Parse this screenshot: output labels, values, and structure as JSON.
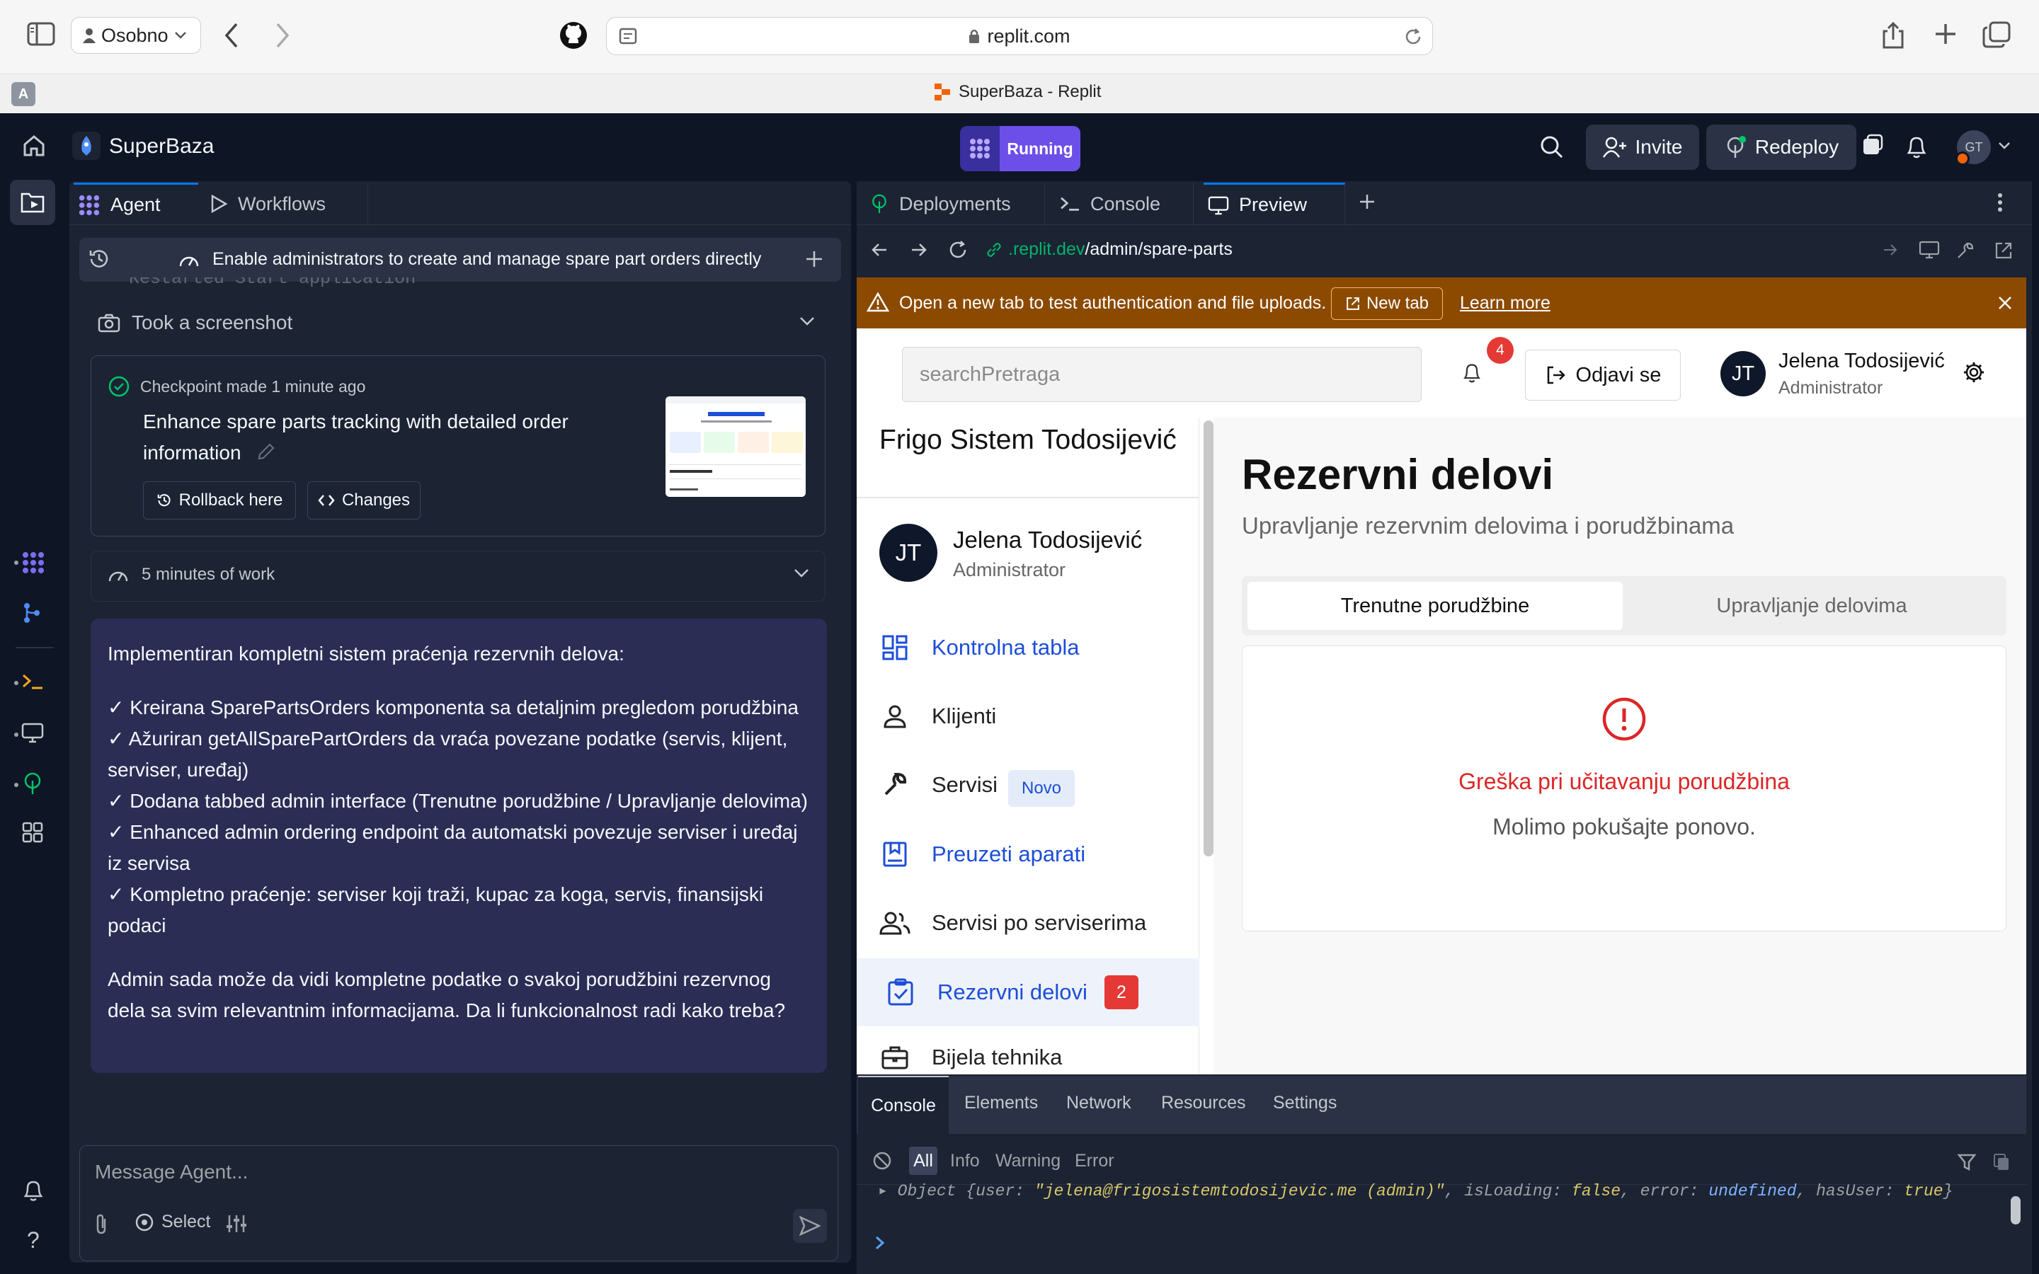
{
  "browser": {
    "profile": "Osobno",
    "url": "replit.com",
    "tab_title": "SuperBaza - Replit",
    "tab_badge": "A"
  },
  "replit": {
    "app_name": "SuperBaza",
    "status": "Running",
    "invite": "Invite",
    "redeploy": "Redeploy",
    "avatar": "GT"
  },
  "agent_panel": {
    "tabs": [
      "Agent",
      "Workflows"
    ],
    "header": "Enable administrators to create and manage spare part orders directly",
    "restarted": "Restarted Start application",
    "screenshot": "Took a screenshot",
    "checkpoint": {
      "title": "Checkpoint made 1 minute ago",
      "description": "Enhance spare parts tracking with detailed order information",
      "rollback": "Rollback here",
      "changes": "Changes"
    },
    "work": "5 minutes of work",
    "message": [
      "Implementiran kompletni sistem praćenja rezervnih delova:",
      "✓ Kreirana SparePartsOrders komponenta sa detaljnim pregledom porudžbina\n✓ Ažuriran getAllSparePartOrders da vraća povezane podatke (servis, klijent, serviser, uređaj)\n✓ Dodana tabbed admin interface (Trenutne porudžbine / Upravljanje delovima)\n✓ Enhanced admin ordering endpoint da automatski povezuje serviser i uređaj iz servisa\n✓ Kompletno praćenje: serviser koji traži, kupac za koga, servis, finansijski podaci",
      "Admin sada može da vidi kompletne podatke o svakoj porudžbini rezervnog dela sa svim relevantnim informacijama. Da li funkcionalnost radi kako treba?"
    ],
    "composer_placeholder": "Message Agent...",
    "select": "Select"
  },
  "right_panel": {
    "tabs": [
      "Deployments",
      "Console",
      "Preview"
    ],
    "url_domain": ".replit.dev",
    "url_path": "/admin/spare-parts",
    "warning": "Open a new tab to test authentication and file uploads.",
    "new_tab": "New tab",
    "learn_more": "Learn more"
  },
  "webpage": {
    "search_placeholder": "searchPretraga",
    "notifications": "4",
    "logout": "Odjavi se",
    "user_initials": "JT",
    "user_name": "Jelena Todosijević",
    "user_role": "Administrator",
    "brand": "Frigo Sistem Todosijević",
    "nav": [
      {
        "label": "Kontrolna tabla",
        "icon": "dashboard-icon"
      },
      {
        "label": "Klijenti",
        "icon": "person-icon"
      },
      {
        "label": "Servisi",
        "icon": "wrench-icon",
        "badge": "Novo"
      },
      {
        "label": "Preuzeti aparati",
        "icon": "bookmark-box-icon"
      },
      {
        "label": "Servisi po serviserima",
        "icon": "group-icon"
      },
      {
        "label": "Rezervni delovi",
        "icon": "clipboard-check-icon",
        "badge": "2"
      },
      {
        "label": "Bijela tehnika",
        "icon": "briefcase-icon"
      }
    ],
    "title": "Rezervni delovi",
    "subtitle": "Upravljanje rezervnim delovima i porudžbinama",
    "tabs": [
      "Trenutne porudžbine",
      "Upravljanje delovima"
    ],
    "error": "Greška pri učitavanju porudžbina",
    "retry": "Molimo pokušajte ponovo."
  },
  "devtools": {
    "tabs": [
      "Console",
      "Elements",
      "Network",
      "Resources",
      "Settings"
    ],
    "filters": [
      "All",
      "Info",
      "Warning",
      "Error"
    ],
    "log_prefix": "Object {user: ",
    "log_user": "\"jelena@frigosistemtodosijevic.me (admin)\"",
    "log_mid": ", isLoading: ",
    "log_loading": "false",
    "log_err": ", error: ",
    "log_undef": "undefined",
    "log_has": ", hasUser: ",
    "log_true": "true",
    "log_close": "}"
  },
  "colors": {
    "replit_bg": "#0e1525",
    "panel_bg": "#1c2333",
    "running_purple": "#6c4fe8",
    "warning_bg": "#8b4a00",
    "message_bg": "#2b2d55",
    "error_red": "#dc2626",
    "link_blue": "#1d4ed8"
  }
}
